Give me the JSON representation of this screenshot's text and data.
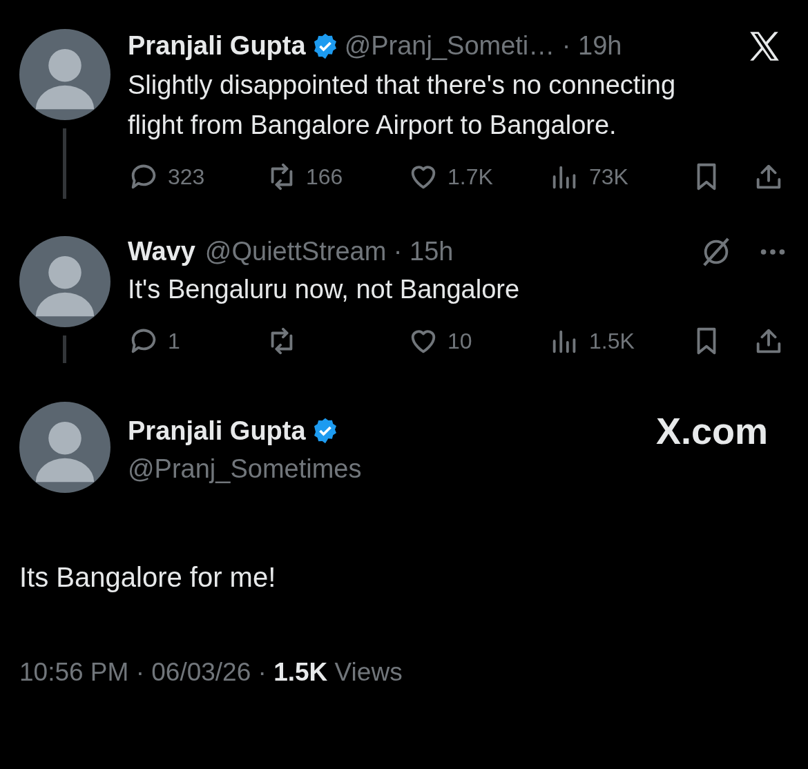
{
  "separator": "·",
  "thread": [
    {
      "name": "Pranjali Gupta",
      "verified": true,
      "handle": "@Pranj_Someti…",
      "time": "19h",
      "kind": "x-logo",
      "text": "Slightly disappointed that there's no connecting flight from Bangalore Airport to Bangalore.",
      "stats": {
        "replies": "323",
        "reposts": "166",
        "likes": "1.7K",
        "views": "73K"
      }
    },
    {
      "name": "Wavy",
      "verified": false,
      "handle": "@QuiettStream",
      "time": "15h",
      "kind": "grok-more",
      "text": "It's Bengaluru now, not Bangalore",
      "stats": {
        "replies": "1",
        "likes": "10",
        "views": "1.5K"
      }
    }
  ],
  "focused": {
    "name": "Pranjali Gupta",
    "verified": true,
    "handle": "@Pranj_Sometimes",
    "brand": "X.com",
    "text": "Its Bangalore for me!",
    "time": "10:56 PM",
    "date": "06/03/26",
    "views_count": "1.5K",
    "views_label": "Views"
  }
}
